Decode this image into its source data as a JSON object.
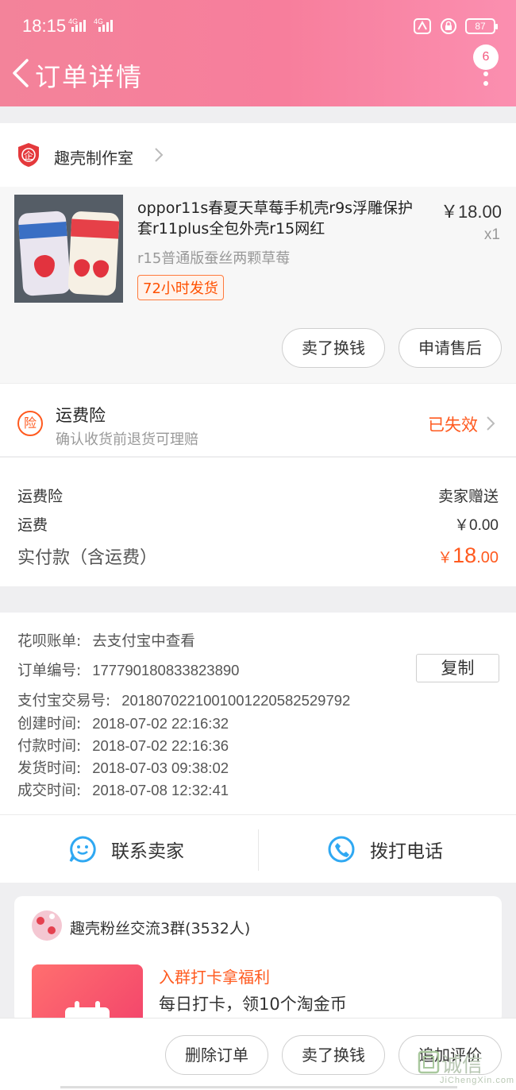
{
  "status_bar": {
    "time": "18:15",
    "network_1": "4G",
    "network_2": "4G",
    "battery": "87"
  },
  "header": {
    "title": "订单详情",
    "badge_count": "6"
  },
  "shop": {
    "name": "趣壳制作室"
  },
  "product": {
    "title": "oppor11s春夏天草莓手机壳r9s浮雕保护套r11plus全包外壳r15网红",
    "price": "￥18.00",
    "quantity": "x1",
    "sku": "r15普通版蚕丝两颗草莓",
    "tag": "72小时发货",
    "buttons": [
      "卖了换钱",
      "申请售后"
    ]
  },
  "insurance": {
    "title": "运费险",
    "subtitle": "确认收货前退货可理赔",
    "status": "已失效"
  },
  "fees": {
    "rows": [
      {
        "label": "运费险",
        "value": "卖家赠送"
      },
      {
        "label": "运费",
        "value": "￥0.00"
      }
    ],
    "paid_label": "实付款（含运费）",
    "paid_currency": "￥",
    "paid_integer": "18",
    "paid_decimal": ".00"
  },
  "order_info": {
    "rows": [
      {
        "label": "花呗账单:",
        "value": "去支付宝中查看"
      },
      {
        "label": "订单编号:",
        "value": "177790180833823890"
      },
      {
        "label": "支付宝交易号:",
        "value": "2018070221001001220582529792"
      },
      {
        "label": "创建时间:",
        "value": "2018-07-02 22:16:32"
      },
      {
        "label": "付款时间:",
        "value": "2018-07-02 22:16:36"
      },
      {
        "label": "发货时间:",
        "value": "2018-07-03 09:38:02"
      },
      {
        "label": "成交时间:",
        "value": "2018-07-08 12:32:41"
      }
    ],
    "copy_label": "复制"
  },
  "contact": {
    "seller": "联系卖家",
    "phone": "拨打电话"
  },
  "group": {
    "name": "趣壳粉丝交流3群(3532人)",
    "promo": "入群打卡拿福利",
    "desc": "每日打卡，领10个淘金币"
  },
  "bottom_actions": [
    "删除订单",
    "卖了换钱",
    "追加评价"
  ],
  "watermark": {
    "text": "诚信",
    "sub": "JiChengXin.com"
  },
  "colors": {
    "accent": "#ff5a1f",
    "header_start": "#f3839a",
    "header_end": "#fb8fb0"
  }
}
